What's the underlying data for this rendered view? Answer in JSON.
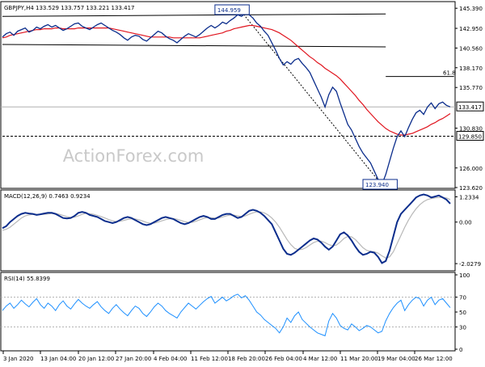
{
  "chart_data": [
    {
      "type": "line",
      "panel": "price",
      "title": "GBPJPY,H4  133.529 133.757 133.221 133.417",
      "watermark": "ActionForex.com",
      "ylim": [
        123.62,
        146.0
      ],
      "y_ticks": [
        "145.390",
        "142.950",
        "140.560",
        "138.170",
        "135.770",
        "133.417",
        "130.830",
        "129.850",
        "126.000",
        "123.620"
      ],
      "last_price": "133.417",
      "level_label": "129.850",
      "fib_label": "61.8",
      "annotations": [
        "144.959",
        "123.940"
      ],
      "series": [
        {
          "name": "Close",
          "values": [
            141.9,
            142.3,
            142.5,
            142.1,
            142.6,
            142.8,
            143.0,
            142.5,
            142.7,
            143.1,
            142.9,
            143.2,
            143.4,
            143.1,
            143.3,
            143.0,
            142.7,
            142.9,
            143.2,
            143.5,
            143.6,
            143.2,
            143.0,
            142.8,
            143.1,
            143.4,
            143.6,
            143.3,
            143.0,
            142.7,
            142.5,
            142.2,
            141.8,
            141.5,
            141.9,
            142.1,
            142.0,
            141.6,
            141.4,
            141.8,
            142.2,
            142.6,
            142.4,
            142.0,
            141.7,
            141.5,
            141.2,
            141.6,
            142.0,
            142.3,
            142.1,
            141.9,
            142.2,
            142.6,
            143.0,
            143.3,
            143.0,
            143.3,
            143.7,
            143.5,
            143.9,
            144.2,
            144.6,
            144.4,
            144.8,
            144.6,
            144.2,
            143.6,
            143.2,
            142.6,
            142.1,
            141.2,
            140.3,
            139.3,
            138.5,
            138.9,
            138.6,
            139.1,
            139.3,
            138.7,
            138.2,
            137.6,
            136.6,
            135.6,
            134.6,
            133.4,
            134.9,
            135.8,
            135.3,
            133.9,
            132.6,
            131.3,
            130.6,
            129.6,
            128.6,
            127.8,
            127.2,
            126.6,
            125.6,
            124.6,
            124.0,
            125.2,
            126.8,
            128.4,
            129.8,
            130.5,
            129.8,
            130.9,
            131.9,
            132.7,
            133.0,
            132.5,
            133.4,
            133.9,
            133.2,
            133.8,
            134.0,
            133.6,
            133.417
          ]
        },
        {
          "name": "SMA",
          "values": [
            141.8,
            141.9,
            142.1,
            142.2,
            142.3,
            142.4,
            142.5,
            142.6,
            142.7,
            142.8,
            142.8,
            142.9,
            142.9,
            142.9,
            143.0,
            143.0,
            142.9,
            142.9,
            142.9,
            142.9,
            143.0,
            143.0,
            143.0,
            143.0,
            143.0,
            143.0,
            143.0,
            143.0,
            143.0,
            142.9,
            142.8,
            142.7,
            142.6,
            142.5,
            142.4,
            142.3,
            142.2,
            142.1,
            142.0,
            141.9,
            141.9,
            141.9,
            141.9,
            141.9,
            141.9,
            141.8,
            141.8,
            141.8,
            141.8,
            141.8,
            141.8,
            141.8,
            141.8,
            141.9,
            142.0,
            142.1,
            142.2,
            142.3,
            142.4,
            142.6,
            142.7,
            142.9,
            143.0,
            143.1,
            143.2,
            143.3,
            143.3,
            143.2,
            143.1,
            143.0,
            142.9,
            142.8,
            142.6,
            142.4,
            142.1,
            141.8,
            141.5,
            141.1,
            140.7,
            140.3,
            139.9,
            139.5,
            139.2,
            138.8,
            138.5,
            138.1,
            137.8,
            137.5,
            137.2,
            136.8,
            136.3,
            135.8,
            135.3,
            134.8,
            134.2,
            133.7,
            133.1,
            132.6,
            132.1,
            131.6,
            131.2,
            130.8,
            130.5,
            130.3,
            130.1,
            130.0,
            130.0,
            130.1,
            130.2,
            130.4,
            130.6,
            130.8,
            131.0,
            131.3,
            131.5,
            131.8,
            132.0,
            132.3,
            132.6
          ]
        }
      ],
      "lines": [
        {
          "name": "channel-top",
          "from": [
            0,
            144.4
          ],
          "to": [
            101,
            144.7
          ]
        },
        {
          "name": "channel-bottom",
          "from": [
            0,
            141.0
          ],
          "to": [
            101,
            140.7
          ]
        },
        {
          "name": "fib-61.8",
          "from": [
            101,
            137.1
          ],
          "to": [
            119,
            137.1
          ]
        },
        {
          "name": "level-129.850",
          "from": [
            0,
            129.85
          ],
          "to": [
            119,
            129.85
          ]
        },
        {
          "name": "drop-line",
          "from": [
            63,
            144.959
          ],
          "to": [
            100,
            123.94
          ]
        }
      ]
    },
    {
      "type": "line",
      "panel": "macd",
      "title": "MACD(12,26,9) 0.7463 0.9234",
      "ylim": [
        -2.3,
        1.45
      ],
      "y_ticks": [
        "1.2334",
        "0.00",
        "-2.0279"
      ],
      "series": [
        {
          "name": "MACD",
          "values": [
            -0.3,
            -0.2,
            0.0,
            0.15,
            0.3,
            0.4,
            0.45,
            0.42,
            0.4,
            0.35,
            0.38,
            0.42,
            0.45,
            0.45,
            0.4,
            0.3,
            0.2,
            0.18,
            0.2,
            0.3,
            0.45,
            0.5,
            0.45,
            0.35,
            0.3,
            0.25,
            0.15,
            0.05,
            0.0,
            -0.05,
            0.0,
            0.1,
            0.2,
            0.25,
            0.2,
            0.1,
            0.0,
            -0.1,
            -0.15,
            -0.1,
            0.0,
            0.1,
            0.2,
            0.25,
            0.2,
            0.15,
            0.05,
            -0.05,
            -0.1,
            -0.05,
            0.05,
            0.15,
            0.25,
            0.3,
            0.25,
            0.15,
            0.15,
            0.25,
            0.35,
            0.4,
            0.4,
            0.3,
            0.2,
            0.25,
            0.4,
            0.55,
            0.6,
            0.55,
            0.45,
            0.3,
            0.1,
            -0.1,
            -0.5,
            -0.9,
            -1.3,
            -1.55,
            -1.6,
            -1.5,
            -1.35,
            -1.2,
            -1.05,
            -0.9,
            -0.8,
            -0.85,
            -1.0,
            -1.2,
            -1.35,
            -1.2,
            -0.9,
            -0.6,
            -0.5,
            -0.65,
            -0.9,
            -1.2,
            -1.45,
            -1.6,
            -1.55,
            -1.45,
            -1.5,
            -1.7,
            -2.0,
            -1.9,
            -1.4,
            -0.7,
            0.0,
            0.4,
            0.6,
            0.8,
            1.0,
            1.2,
            1.3,
            1.35,
            1.3,
            1.2,
            1.25,
            1.3,
            1.2,
            1.1,
            0.9
          ]
        },
        {
          "name": "Signal",
          "values": [
            -0.4,
            -0.35,
            -0.25,
            -0.1,
            0.05,
            0.2,
            0.3,
            0.35,
            0.38,
            0.38,
            0.37,
            0.38,
            0.4,
            0.42,
            0.42,
            0.38,
            0.32,
            0.26,
            0.23,
            0.24,
            0.3,
            0.38,
            0.42,
            0.41,
            0.38,
            0.33,
            0.27,
            0.2,
            0.12,
            0.06,
            0.03,
            0.04,
            0.08,
            0.13,
            0.16,
            0.15,
            0.11,
            0.05,
            -0.02,
            -0.06,
            -0.05,
            0.0,
            0.06,
            0.12,
            0.16,
            0.17,
            0.14,
            0.08,
            0.02,
            -0.02,
            -0.01,
            0.04,
            0.11,
            0.18,
            0.22,
            0.21,
            0.19,
            0.2,
            0.25,
            0.3,
            0.34,
            0.34,
            0.3,
            0.27,
            0.3,
            0.38,
            0.45,
            0.5,
            0.5,
            0.45,
            0.35,
            0.2,
            0.0,
            -0.25,
            -0.55,
            -0.85,
            -1.1,
            -1.28,
            -1.35,
            -1.33,
            -1.25,
            -1.12,
            -1.0,
            -0.93,
            -0.93,
            -1.0,
            -1.1,
            -1.16,
            -1.12,
            -0.98,
            -0.8,
            -0.7,
            -0.72,
            -0.85,
            -1.05,
            -1.25,
            -1.38,
            -1.43,
            -1.45,
            -1.52,
            -1.65,
            -1.75,
            -1.7,
            -1.45,
            -1.05,
            -0.65,
            -0.25,
            0.1,
            0.4,
            0.65,
            0.85,
            1.0,
            1.1,
            1.15,
            1.18,
            1.2,
            1.2,
            1.18,
            1.1
          ]
        }
      ]
    },
    {
      "type": "line",
      "panel": "rsi",
      "title": "RSI(14) 55.8399",
      "ylim": [
        0,
        100
      ],
      "y_ticks": [
        "100",
        "70",
        "50",
        "30",
        "0"
      ],
      "levels": [
        70,
        30
      ],
      "series": [
        {
          "name": "RSI",
          "values": [
            52,
            58,
            62,
            55,
            60,
            66,
            61,
            57,
            63,
            68,
            60,
            55,
            62,
            58,
            52,
            60,
            65,
            58,
            54,
            61,
            67,
            62,
            58,
            55,
            60,
            64,
            57,
            52,
            48,
            55,
            60,
            54,
            49,
            45,
            52,
            58,
            55,
            48,
            44,
            50,
            57,
            62,
            58,
            52,
            48,
            45,
            42,
            50,
            56,
            62,
            58,
            54,
            59,
            64,
            68,
            71,
            62,
            66,
            70,
            65,
            68,
            72,
            74,
            69,
            72,
            66,
            58,
            50,
            46,
            40,
            36,
            32,
            28,
            22,
            30,
            42,
            36,
            45,
            50,
            40,
            35,
            30,
            26,
            22,
            20,
            18,
            38,
            48,
            42,
            32,
            28,
            26,
            34,
            30,
            25,
            28,
            32,
            30,
            26,
            22,
            24,
            38,
            48,
            56,
            62,
            66,
            52,
            60,
            66,
            70,
            68,
            58,
            66,
            70,
            60,
            66,
            68,
            62,
            55.8399
          ]
        }
      ]
    },
    {
      "type": "table",
      "panel": "time-axis",
      "x_tick_labels": [
        "3 Jan 2020",
        "13 Jan 04:00",
        "20 Jan 12:00",
        "27 Jan 20:00",
        "4 Feb 04:00",
        "11 Feb 12:00",
        "18 Feb 20:00",
        "26 Feb 04:00",
        "4 Mar 12:00",
        "11 Mar 20:00",
        "19 Mar 04:00",
        "26 Mar 12:00"
      ]
    }
  ]
}
